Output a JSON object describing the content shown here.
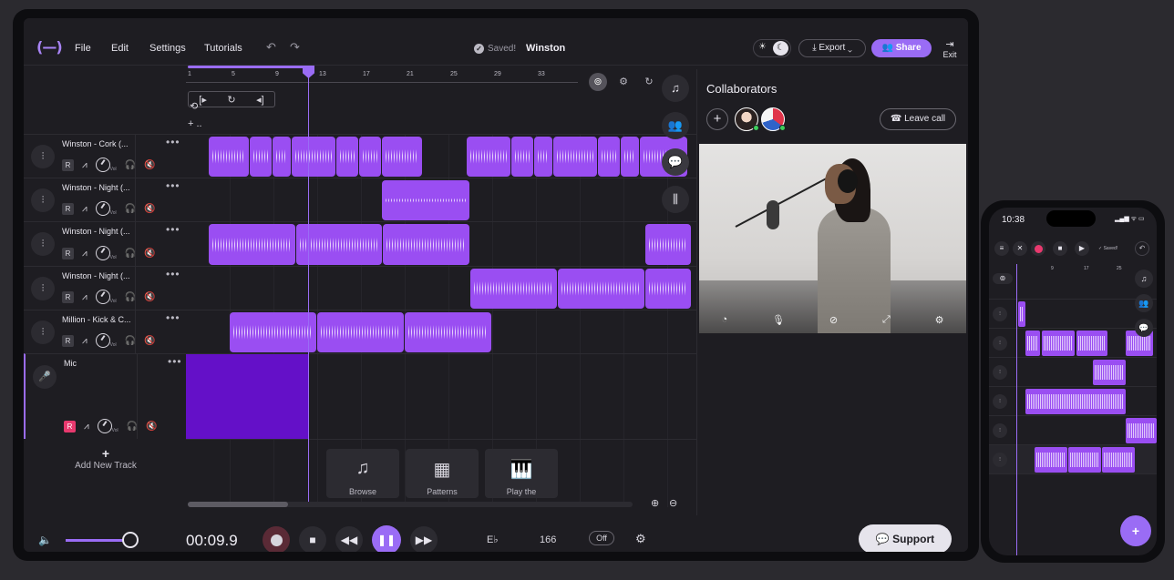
{
  "app": {
    "project_name": "Winston",
    "saved_status": "Saved!",
    "menu": [
      {
        "label": "File"
      },
      {
        "label": "Edit"
      },
      {
        "label": "Settings"
      },
      {
        "label": "Tutorials"
      }
    ],
    "export_label": "Export",
    "share_label": "Share",
    "exit_label": "Exit"
  },
  "timeline": {
    "bar_numbers": [
      "1",
      "5",
      "9",
      "13",
      "17",
      "21",
      "25",
      "29",
      "33"
    ]
  },
  "tracks": [
    {
      "name": "Winston - Cork (...",
      "record_armed": false,
      "vol_label": "Vol"
    },
    {
      "name": "Winston - Night (...",
      "record_armed": false,
      "vol_label": "Vol"
    },
    {
      "name": "Winston - Night (...",
      "record_armed": false,
      "vol_label": "Vol"
    },
    {
      "name": "Winston - Night (...",
      "record_armed": false,
      "vol_label": "Vol"
    },
    {
      "name": "Million - Kick & C...",
      "record_armed": false,
      "vol_label": "Vol"
    },
    {
      "name": "Mic",
      "record_armed": true,
      "vol_label": "Vol"
    }
  ],
  "record_button_letter": "R",
  "add_track_label": "Add New Track",
  "bottom_cards": [
    {
      "label": "Browse",
      "icon": "music-note-icon"
    },
    {
      "label": "Patterns",
      "icon": "patterns-grid-icon"
    },
    {
      "label": "Play the",
      "icon": "piano-keys-icon"
    }
  ],
  "collaborators": {
    "title": "Collaborators",
    "leave_call_label": "Leave call"
  },
  "transport": {
    "timecode": "00:09.9",
    "key": "E♭",
    "bpm": "166",
    "metronome": "Off",
    "support_label": "Support"
  },
  "phone": {
    "clock": "10:38",
    "saved_status": "Saved!",
    "bar_numbers": [
      "9",
      "17",
      "25"
    ]
  },
  "colors": {
    "accent": "#9a6cf5",
    "clip": "#9a4ef2",
    "record": "#e8396e",
    "background": "#1e1d22"
  }
}
